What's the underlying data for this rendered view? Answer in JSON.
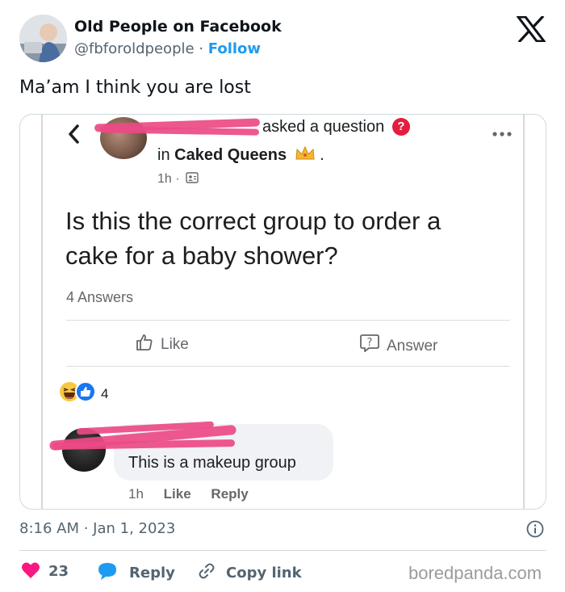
{
  "tweet": {
    "display_name": "Old People on Facebook",
    "handle": "@fbforoldpeople",
    "separator": "·",
    "follow_label": "Follow",
    "text": "Ma’am I think you are lost",
    "timestamp": "8:16 AM · Jan 1, 2023",
    "likes": "23",
    "reply_label": "Reply",
    "copy_link_label": "Copy link",
    "icons": {
      "brand": "x-logo-icon",
      "likes": "heart-icon",
      "reply": "speech-bubble-icon",
      "copy_link": "link-icon",
      "info": "info-icon"
    }
  },
  "embedded_post": {
    "asked_text": "asked a question",
    "group_prefix": "in",
    "group_name": "Caked Queens",
    "group_suffix": ".",
    "time": "1h ·",
    "question": "Is this the correct group to order a cake for a baby shower?",
    "answers_count": "4 Answers",
    "like_label": "Like",
    "answer_label": "Answer",
    "reaction_count": "4",
    "comment": {
      "text": "This is a makeup group",
      "time": "1h",
      "like_label": "Like",
      "reply_label": "Reply"
    },
    "icons": {
      "back": "chevron-left-icon",
      "question_badge": "question-badge-icon",
      "crown": "crown-icon",
      "audience": "members-icon",
      "more": "more-options-icon",
      "like": "thumbs-up-icon",
      "answer": "question-bubble-icon",
      "reactions": [
        "haha-reaction-icon",
        "like-reaction-icon"
      ]
    }
  },
  "watermark": "boredpanda.com",
  "colors": {
    "brand_blue": "#1d9bf0",
    "heart": "#f91880",
    "redaction": "#ec4a86",
    "muted_text": "#536471"
  }
}
